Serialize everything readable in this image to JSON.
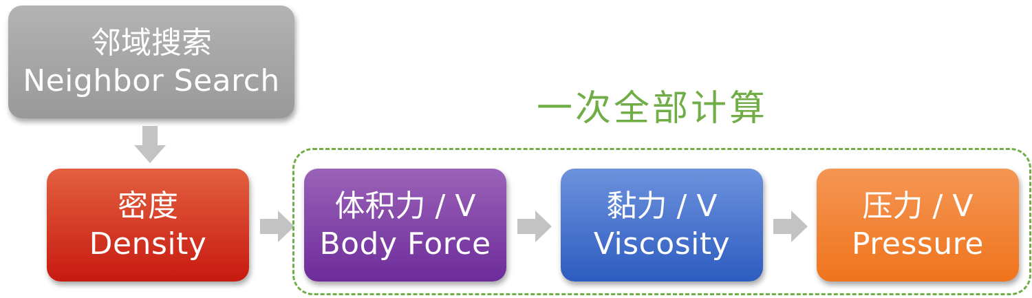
{
  "group": {
    "label": "一次全部计算",
    "color": "#70ad47"
  },
  "steps": [
    {
      "zh": "邻域搜索",
      "en": "Neighbor Search",
      "color": "#a6a6a6"
    },
    {
      "zh": "密度",
      "en": "Density",
      "color": "#d63a22"
    },
    {
      "zh": "体积力 / V",
      "en": "Body Force",
      "color": "#7f3fa8"
    },
    {
      "zh": "黏力 / V",
      "en": "Viscosity",
      "color": "#4472c4"
    },
    {
      "zh": "压力 / V",
      "en": "Pressure",
      "color": "#f08430"
    }
  ],
  "arrow_color": "#c3c3c3"
}
